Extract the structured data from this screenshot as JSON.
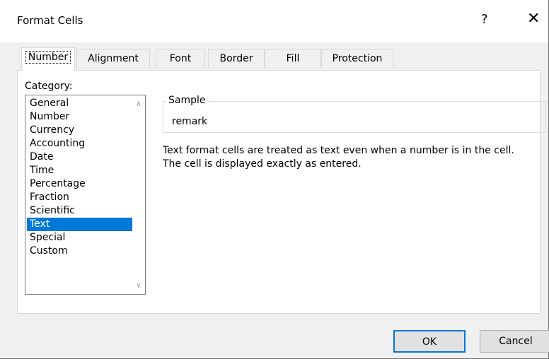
{
  "window": {
    "title": "Format Cells",
    "help_label": "?",
    "close_label": "✕"
  },
  "tabs": [
    {
      "label": "Number",
      "active": true
    },
    {
      "label": "Alignment"
    },
    {
      "label": "Font"
    },
    {
      "label": "Border"
    },
    {
      "label": "Fill"
    },
    {
      "label": "Protection"
    }
  ],
  "category": {
    "label": "Category:",
    "items": [
      "General",
      "Number",
      "Currency",
      "Accounting",
      "Date",
      "Time",
      "Percentage",
      "Fraction",
      "Scientific",
      "Text",
      "Special",
      "Custom"
    ],
    "selected": "Text"
  },
  "sample": {
    "label": "Sample",
    "value": "remark"
  },
  "description": {
    "line1": "Text format cells are treated as text even when a number is in the cell.",
    "line2": "The cell is displayed exactly as entered."
  },
  "buttons": {
    "ok_label": "OK",
    "cancel_label": "Cancel"
  },
  "colors": {
    "selection": "#0078d7",
    "dialog_bg": "#f0f0f0",
    "panel_bg": "#ffffff"
  }
}
